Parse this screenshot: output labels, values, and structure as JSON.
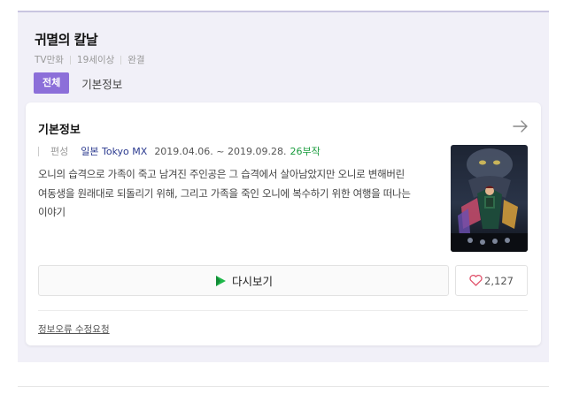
{
  "title": "귀멸의 칼날",
  "meta": [
    "TV만화",
    "19세이상",
    "완결"
  ],
  "tabs": {
    "all_label": "전체",
    "info_label": "기본정보"
  },
  "info_card": {
    "heading": "기본정보",
    "broadcast_label": "편성",
    "channel": "일본 Tokyo MX",
    "dates": "2019.04.06. ~ 2019.09.28.",
    "episodes": "26부작",
    "synopsis": "오니의 습격으로 가족이 죽고 남겨진 주인공은 그 습격에서 살아남았지만 오니로 변해버린 여동생을 원래대로 되돌리기 위해, 그리고 가족을 죽인 오니에 복수하기 위한 여행을 떠나는 이야기",
    "rewatch_label": "다시보기",
    "like_count": "2,127",
    "report_label": "정보오류 수정요청"
  },
  "colors": {
    "accent": "#8c6fd9",
    "panel_bg": "#f1f0f8",
    "episodes": "#1a9c3e",
    "channel": "#2b3a8f",
    "heart": "#e0526b",
    "play": "#1fb84a"
  },
  "icons": {
    "arrow": "arrow-right-icon",
    "play": "play-icon",
    "heart": "heart-icon"
  }
}
